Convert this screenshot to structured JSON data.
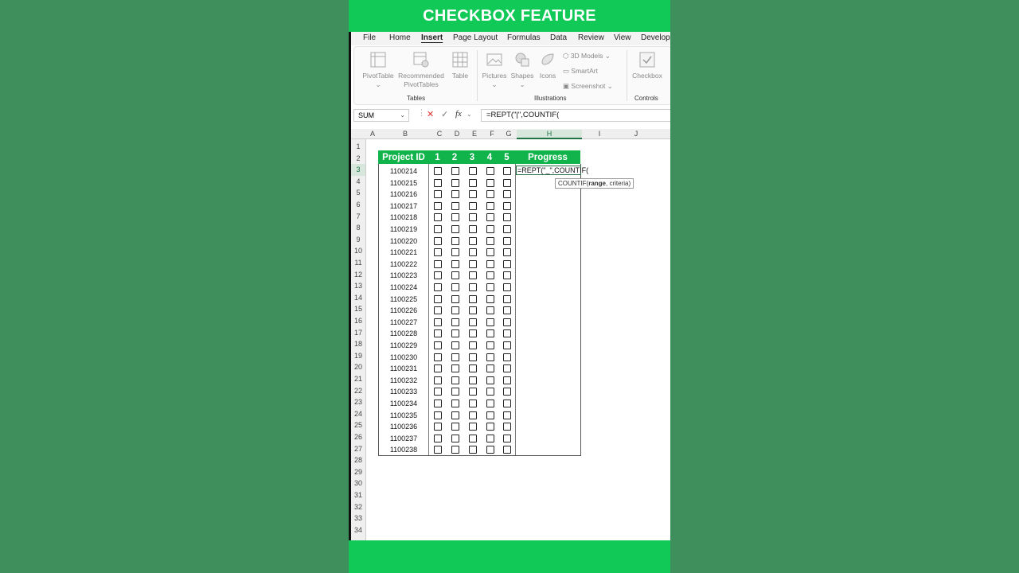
{
  "banner": {
    "title": "CHECKBOX FEATURE"
  },
  "menu": [
    "File",
    "Home",
    "Insert",
    "Page Layout",
    "Formulas",
    "Data",
    "Review",
    "View",
    "Develope"
  ],
  "menu_active": "Insert",
  "ribbon": {
    "tables": {
      "pivot": "PivotTable",
      "recommended_1": "Recommended",
      "recommended_2": "PivotTables",
      "table": "Table",
      "group": "Tables"
    },
    "illustrations": {
      "pictures": "Pictures",
      "shapes": "Shapes",
      "icons": "Icons",
      "models": "3D Models",
      "smartart": "SmartArt",
      "screenshot": "Screenshot",
      "group": "Illustrations"
    },
    "controls": {
      "checkbox": "Checkbox",
      "group": "Controls"
    }
  },
  "formula_bar": {
    "name_box": "SUM",
    "formula": "=REPT(\"|\",COUNTIF(",
    "fx": "fx"
  },
  "columns": [
    "A",
    "B",
    "C",
    "D",
    "E",
    "F",
    "G",
    "H",
    "I",
    "J"
  ],
  "selected_column": "H",
  "rows": [
    "1",
    "2",
    "3",
    "4",
    "5",
    "6",
    "7",
    "8",
    "9",
    "10",
    "11",
    "12",
    "13",
    "14",
    "15",
    "16",
    "17",
    "18",
    "19",
    "20",
    "21",
    "22",
    "23",
    "24",
    "25",
    "26",
    "27",
    "28",
    "29",
    "30",
    "31",
    "32",
    "33",
    "34"
  ],
  "selected_row": "3",
  "table": {
    "headers": {
      "project_id": "Project ID",
      "c1": "1",
      "c2": "2",
      "c3": "3",
      "c4": "4",
      "c5": "5",
      "progress": "Progress"
    },
    "project_ids": [
      "1100214",
      "1100215",
      "1100216",
      "1100217",
      "1100218",
      "1100219",
      "1100220",
      "1100221",
      "1100222",
      "1100223",
      "1100224",
      "1100225",
      "1100226",
      "1100227",
      "1100228",
      "1100229",
      "1100230",
      "1100231",
      "1100232",
      "1100233",
      "1100234",
      "1100235",
      "1100236",
      "1100237",
      "1100238"
    ],
    "checkbox_count_per_row": 5
  },
  "active_cell": {
    "content": "=REPT(\"_\",COUNTIF("
  },
  "tooltip": {
    "fn": "COUNTIF(",
    "arg": "range",
    "rest": ", criteria)"
  },
  "colors": {
    "banner": "#10c957",
    "header_fill": "#10b44a",
    "background": "#3f8f5d",
    "excel_green": "#217346"
  }
}
